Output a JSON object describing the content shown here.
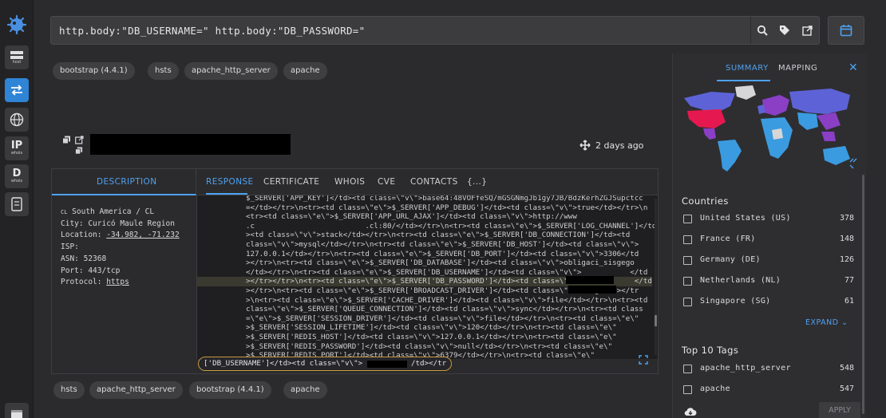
{
  "search": {
    "query": "http.body:\"DB_USERNAME=\" http.body:\"DB_PASSWORD=\""
  },
  "rail": {
    "host_label": "host",
    "ip_big": "IP",
    "ip_small": "whois",
    "d_big": "D",
    "d_small": "whois"
  },
  "top_tags": [
    "bootstrap (4.4.1)",
    "hsts",
    "apache_http_server",
    "apache"
  ],
  "bottom_tags": [
    "hsts",
    "apache_http_server",
    "bootstrap (4.4.1)",
    "apache"
  ],
  "result": {
    "time_ago": "2 days ago"
  },
  "tabs": {
    "description": "DESCRIPTION",
    "response": "RESPONSE",
    "certificate": "CERTIFICATE",
    "whois": "WHOIS",
    "cve": "CVE",
    "contacts": "CONTACTS",
    "more": "{...}"
  },
  "info": {
    "country_code": "CL",
    "region": "South America / CL",
    "city": "City: Curicó Maule Region",
    "location_label": "Location: ",
    "location_value": "-34.982, -71.232",
    "isp": "ISP:",
    "asn": "ASN: 52368",
    "port": "Port: 443/tcp",
    "protocol_label": "Protocol: ",
    "protocol_value": "https"
  },
  "response_lines": [
    "$_SERVER['APP_KEY']</td><td class=\\\"v\\\">base64:48VOFfeSQ/mGSGNmgJb1gy7JB/BdzKerhZGJSupctcc",
    "=</td></tr>\\n<tr><td class=\\\"e\\\">$_SERVER['APP_DEBUG']</td><td class=\\\"v\\\">true</td></tr>\\n",
    "<tr><td class=\\\"e\\\">$_SERVER['APP_URL_AJAX']</td><td class=\\\"v\\\">http://www",
    ".c                         .cl:80/</td></tr>\\n<tr><td class=\\\"e\\\">$_SERVER['LOG_CHANNEL']</td",
    "><td class=\\\"v\\\">stack</td></tr>\\n<tr><td class=\\\"e\\\">$_SERVER['DB_CONNECTION']</td><td",
    "class=\\\"v\\\">mysql</td></tr>\\n<tr><td class=\\\"e\\\">$_SERVER['DB_HOST']</td><td class=\\\"v\\\">",
    "127.0.0.1</td></tr>\\n<tr><td class=\\\"e\\\">$_SERVER['DB_PORT']</td><td class=\\\"v\\\">3306</td",
    "></tr>\\n<tr><td class=\\\"e\\\">$_SERVER['DB_DATABASE']</td><td class=\\\"v\\\">obligaci_sisgego",
    "</td></tr>\\n<tr><td class=\\\"e\\\">$_SERVER['DB_USERNAME']</td><td class=\\\"v\\\">           </td",
    "></tr></tr>\\n<tr><td class=\\\"e\\\">$_SERVER['DB_PASSWORD']</td><td class=\\\"v\\\">           </td",
    "></tr>\\n<tr><td class=\\\"e\\\">$_SERVER['BROADCAST_DRIVER']</td><td class=\\\"v\\\">log</td></tr",
    ">\\n<tr><td class=\\\"e\\\">$_SERVER['CACHE_DRIVER']</td><td class=\\\"v\\\">file</td></tr>\\n<tr><td",
    "class=\\\"e\\\">$_SERVER['QUEUE_CONNECTION']</td><td class=\\\"v\\\">sync</td></tr>\\n<tr><td class",
    "=\\\"e\\\">$_SERVER['SESSION_DRIVER']</td><td class=\\\"v\\\">file</td></tr>\\n<tr><td class=\\\"e\\\"",
    ">$_SERVER['SESSION_LIFETIME']</td><td class=\\\"v\\\">120</td></tr>\\n<tr><td class=\\\"e\\\"",
    ">$_SERVER['REDIS_HOST']</td><td class=\\\"v\\\">127.0.0.1</td></tr>\\n<tr><td class=\\\"e\\\"",
    ">$_SERVER['REDIS_PASSWORD']</td><td class=\\\"v\\\">null</td></tr>\\n<tr><td class=\\\"e\\\"",
    ">$_SERVER['REDIS_PORT']</td><td class=\\\"v\\\">6379</td></tr>\\n<tr><td class=\\\"e\\\""
  ],
  "snippet": "['DB_USERNAME']</td><td class=\\\"v\\\">           /td></tr",
  "sidebar": {
    "tab_summary": "SUMMARY",
    "tab_mapping": "MAPPING",
    "countries_title": "Countries",
    "countries": [
      {
        "label": "United States (US)",
        "count": "378"
      },
      {
        "label": "France (FR)",
        "count": "148"
      },
      {
        "label": "Germany (DE)",
        "count": "126"
      },
      {
        "label": "Netherlands (NL)",
        "count": "77"
      },
      {
        "label": "Singapore (SG)",
        "count": "61"
      }
    ],
    "expand": "EXPAND",
    "tags_title": "Top 10 Tags",
    "tags": [
      {
        "label": "apache_http_server",
        "count": "548"
      },
      {
        "label": "apache",
        "count": "547"
      }
    ],
    "apply": "APPLY"
  },
  "colors": {
    "accent": "#4ea2f0",
    "background": "#2b2b2d",
    "map_top": "#e5194f",
    "map_high": "#8a3fc4",
    "map_mid": "#5d63d6",
    "map_low": "#3b9be0"
  }
}
